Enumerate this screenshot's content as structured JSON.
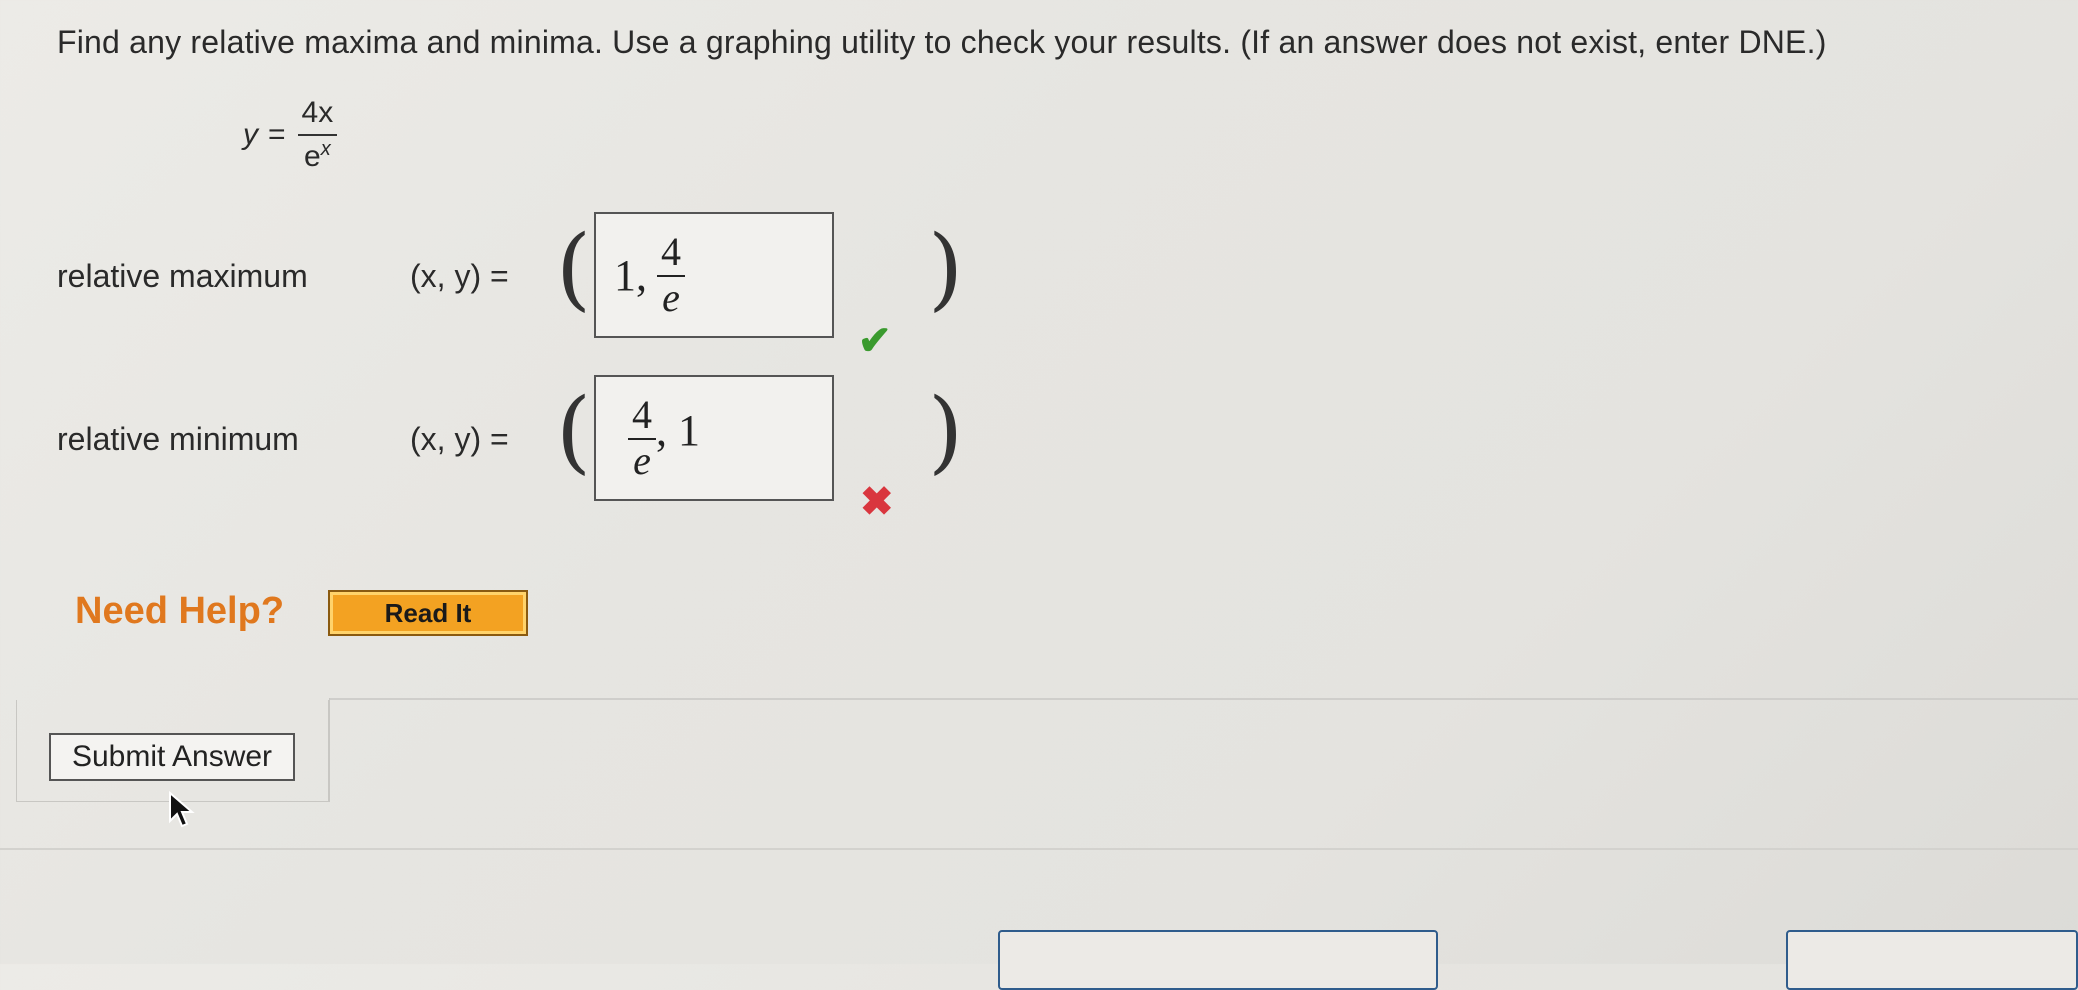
{
  "question": "Find any relative maxima and minima. Use a graphing utility to check your results. (If an answer does not exist, enter DNE.)",
  "equation": {
    "lhs": "y",
    "equals": "=",
    "numerator": "4x",
    "denominator_base": "e",
    "denominator_exp": "x"
  },
  "rows": [
    {
      "label": "relative maximum",
      "xy": "(x, y)  =",
      "answer_lead": "1,",
      "answer_frac_num": "4",
      "answer_frac_den": "e",
      "status": "correct"
    },
    {
      "label": "relative minimum",
      "xy": "(x, y)  =",
      "answer_frac_num": "4",
      "answer_frac_den": "e",
      "answer_tail": ", 1",
      "status": "incorrect"
    }
  ],
  "help": {
    "label": "Need Help?",
    "read_it": "Read It"
  },
  "submit_label": "Submit Answer",
  "colors": {
    "correct": "#3a9a2e",
    "incorrect": "#d9363e",
    "help_text": "#e0781e",
    "read_it_bg": "#f3a222"
  },
  "icons": {
    "correct": "check-icon",
    "incorrect": "x-mark-icon",
    "cursor": "mouse-pointer-icon"
  }
}
